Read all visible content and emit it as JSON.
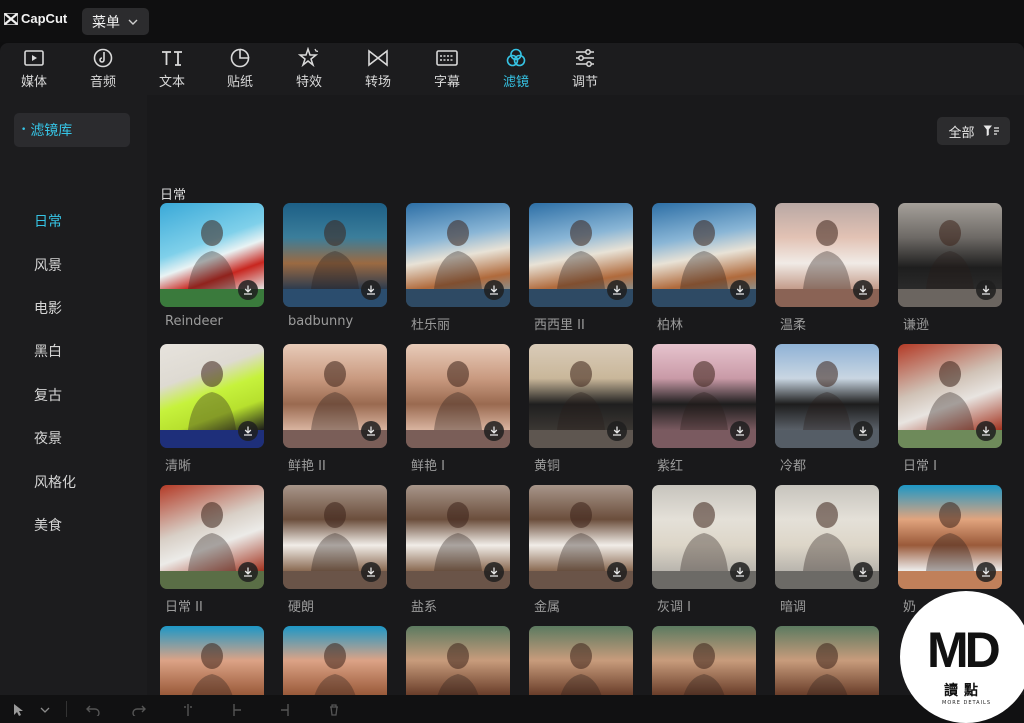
{
  "app": {
    "logo_text": "CapCut",
    "menu_label": "菜单"
  },
  "tabs": [
    {
      "label": "媒体",
      "icon": "media-icon",
      "active": false
    },
    {
      "label": "音频",
      "icon": "audio-icon",
      "active": false
    },
    {
      "label": "文本",
      "icon": "text-icon",
      "active": false
    },
    {
      "label": "贴纸",
      "icon": "sticker-icon",
      "active": false
    },
    {
      "label": "特效",
      "icon": "effects-icon",
      "active": false
    },
    {
      "label": "转场",
      "icon": "transition-icon",
      "active": false
    },
    {
      "label": "字幕",
      "icon": "captions-icon",
      "active": false
    },
    {
      "label": "滤镜",
      "icon": "filters-icon",
      "active": true
    },
    {
      "label": "调节",
      "icon": "adjust-icon",
      "active": false
    }
  ],
  "sidebar": {
    "header": "滤镜库",
    "items": [
      "日常",
      "风景",
      "电影",
      "黑白",
      "复古",
      "夜景",
      "风格化",
      "美食"
    ],
    "active_item": "日常"
  },
  "content": {
    "filter_button": "全部",
    "section_title": "日常",
    "cards": [
      {
        "label": "Reindeer",
        "band": "#3a7a3c"
      },
      {
        "label": "badbunny",
        "band": "#2b4d6e"
      },
      {
        "label": "杜乐丽",
        "band": "#2e4a64"
      },
      {
        "label": "西西里 II",
        "band": "#2e4a64"
      },
      {
        "label": "柏林",
        "band": "#2e4a64"
      },
      {
        "label": "温柔",
        "band": "#8a6355"
      },
      {
        "label": "谦逊",
        "band": "#6b6560"
      },
      {
        "label": "清晰",
        "band": "#1e2f7a"
      },
      {
        "label": "鲜艳 II",
        "band": "#7a5e58"
      },
      {
        "label": "鲜艳 I",
        "band": "#7a5e58"
      },
      {
        "label": "黄铜",
        "band": "#5e5650"
      },
      {
        "label": "紫红",
        "band": "#7a5a60"
      },
      {
        "label": "冷都",
        "band": "#555d66"
      },
      {
        "label": "日常 I",
        "band": "#6e8a5a"
      },
      {
        "label": "日常 II",
        "band": "#5a6e46"
      },
      {
        "label": "硬朗",
        "band": "#6a5448"
      },
      {
        "label": "盐系",
        "band": "#6a5448"
      },
      {
        "label": "金属",
        "band": "#6a5448"
      },
      {
        "label": "灰调 I",
        "band": "#6c6a66"
      },
      {
        "label": "暗调",
        "band": "#6c6a66"
      },
      {
        "label": "奶",
        "band": "#c0805a"
      },
      {
        "label": "",
        "band": "#2f7fa8"
      },
      {
        "label": "",
        "band": "#2f7fa8"
      },
      {
        "label": "",
        "band": "#7a5e4e"
      },
      {
        "label": "",
        "band": "#7a5e4e"
      },
      {
        "label": "",
        "band": "#7a5e4e"
      },
      {
        "label": "",
        "band": "#7a5e4e"
      }
    ]
  },
  "watermark": {
    "logo": "MD",
    "cn_text": "讀點",
    "sub_text": "MORE DETAILS"
  },
  "colors": {
    "accent": "#36c4e5",
    "panel": "#1c1c1e",
    "content": "#19191b"
  }
}
